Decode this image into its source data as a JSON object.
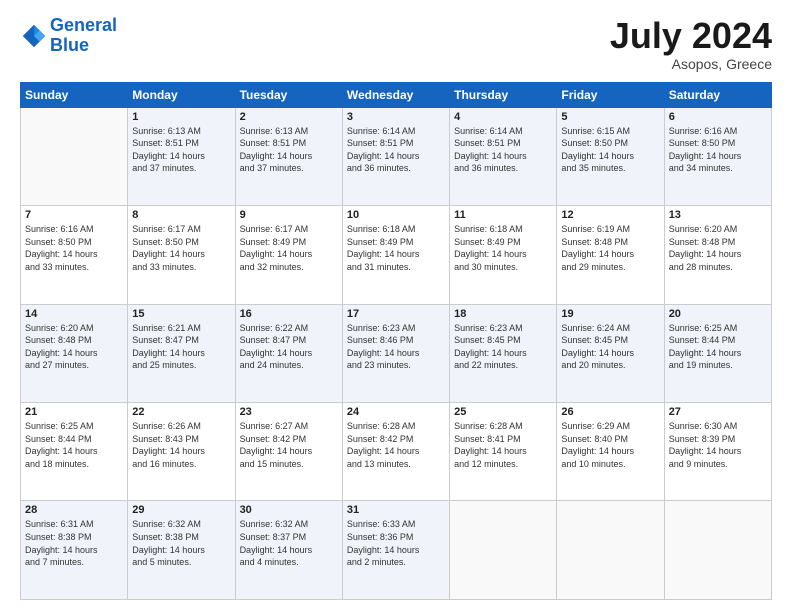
{
  "logo": {
    "line1": "General",
    "line2": "Blue"
  },
  "title": "July 2024",
  "location": "Asopos, Greece",
  "weekdays": [
    "Sunday",
    "Monday",
    "Tuesday",
    "Wednesday",
    "Thursday",
    "Friday",
    "Saturday"
  ],
  "weeks": [
    [
      {
        "day": "",
        "info": ""
      },
      {
        "day": "1",
        "info": "Sunrise: 6:13 AM\nSunset: 8:51 PM\nDaylight: 14 hours\nand 37 minutes."
      },
      {
        "day": "2",
        "info": "Sunrise: 6:13 AM\nSunset: 8:51 PM\nDaylight: 14 hours\nand 37 minutes."
      },
      {
        "day": "3",
        "info": "Sunrise: 6:14 AM\nSunset: 8:51 PM\nDaylight: 14 hours\nand 36 minutes."
      },
      {
        "day": "4",
        "info": "Sunrise: 6:14 AM\nSunset: 8:51 PM\nDaylight: 14 hours\nand 36 minutes."
      },
      {
        "day": "5",
        "info": "Sunrise: 6:15 AM\nSunset: 8:50 PM\nDaylight: 14 hours\nand 35 minutes."
      },
      {
        "day": "6",
        "info": "Sunrise: 6:16 AM\nSunset: 8:50 PM\nDaylight: 14 hours\nand 34 minutes."
      }
    ],
    [
      {
        "day": "7",
        "info": "Sunrise: 6:16 AM\nSunset: 8:50 PM\nDaylight: 14 hours\nand 33 minutes."
      },
      {
        "day": "8",
        "info": "Sunrise: 6:17 AM\nSunset: 8:50 PM\nDaylight: 14 hours\nand 33 minutes."
      },
      {
        "day": "9",
        "info": "Sunrise: 6:17 AM\nSunset: 8:49 PM\nDaylight: 14 hours\nand 32 minutes."
      },
      {
        "day": "10",
        "info": "Sunrise: 6:18 AM\nSunset: 8:49 PM\nDaylight: 14 hours\nand 31 minutes."
      },
      {
        "day": "11",
        "info": "Sunrise: 6:18 AM\nSunset: 8:49 PM\nDaylight: 14 hours\nand 30 minutes."
      },
      {
        "day": "12",
        "info": "Sunrise: 6:19 AM\nSunset: 8:48 PM\nDaylight: 14 hours\nand 29 minutes."
      },
      {
        "day": "13",
        "info": "Sunrise: 6:20 AM\nSunset: 8:48 PM\nDaylight: 14 hours\nand 28 minutes."
      }
    ],
    [
      {
        "day": "14",
        "info": "Sunrise: 6:20 AM\nSunset: 8:48 PM\nDaylight: 14 hours\nand 27 minutes."
      },
      {
        "day": "15",
        "info": "Sunrise: 6:21 AM\nSunset: 8:47 PM\nDaylight: 14 hours\nand 25 minutes."
      },
      {
        "day": "16",
        "info": "Sunrise: 6:22 AM\nSunset: 8:47 PM\nDaylight: 14 hours\nand 24 minutes."
      },
      {
        "day": "17",
        "info": "Sunrise: 6:23 AM\nSunset: 8:46 PM\nDaylight: 14 hours\nand 23 minutes."
      },
      {
        "day": "18",
        "info": "Sunrise: 6:23 AM\nSunset: 8:45 PM\nDaylight: 14 hours\nand 22 minutes."
      },
      {
        "day": "19",
        "info": "Sunrise: 6:24 AM\nSunset: 8:45 PM\nDaylight: 14 hours\nand 20 minutes."
      },
      {
        "day": "20",
        "info": "Sunrise: 6:25 AM\nSunset: 8:44 PM\nDaylight: 14 hours\nand 19 minutes."
      }
    ],
    [
      {
        "day": "21",
        "info": "Sunrise: 6:25 AM\nSunset: 8:44 PM\nDaylight: 14 hours\nand 18 minutes."
      },
      {
        "day": "22",
        "info": "Sunrise: 6:26 AM\nSunset: 8:43 PM\nDaylight: 14 hours\nand 16 minutes."
      },
      {
        "day": "23",
        "info": "Sunrise: 6:27 AM\nSunset: 8:42 PM\nDaylight: 14 hours\nand 15 minutes."
      },
      {
        "day": "24",
        "info": "Sunrise: 6:28 AM\nSunset: 8:42 PM\nDaylight: 14 hours\nand 13 minutes."
      },
      {
        "day": "25",
        "info": "Sunrise: 6:28 AM\nSunset: 8:41 PM\nDaylight: 14 hours\nand 12 minutes."
      },
      {
        "day": "26",
        "info": "Sunrise: 6:29 AM\nSunset: 8:40 PM\nDaylight: 14 hours\nand 10 minutes."
      },
      {
        "day": "27",
        "info": "Sunrise: 6:30 AM\nSunset: 8:39 PM\nDaylight: 14 hours\nand 9 minutes."
      }
    ],
    [
      {
        "day": "28",
        "info": "Sunrise: 6:31 AM\nSunset: 8:38 PM\nDaylight: 14 hours\nand 7 minutes."
      },
      {
        "day": "29",
        "info": "Sunrise: 6:32 AM\nSunset: 8:38 PM\nDaylight: 14 hours\nand 5 minutes."
      },
      {
        "day": "30",
        "info": "Sunrise: 6:32 AM\nSunset: 8:37 PM\nDaylight: 14 hours\nand 4 minutes."
      },
      {
        "day": "31",
        "info": "Sunrise: 6:33 AM\nSunset: 8:36 PM\nDaylight: 14 hours\nand 2 minutes."
      },
      {
        "day": "",
        "info": ""
      },
      {
        "day": "",
        "info": ""
      },
      {
        "day": "",
        "info": ""
      }
    ]
  ]
}
